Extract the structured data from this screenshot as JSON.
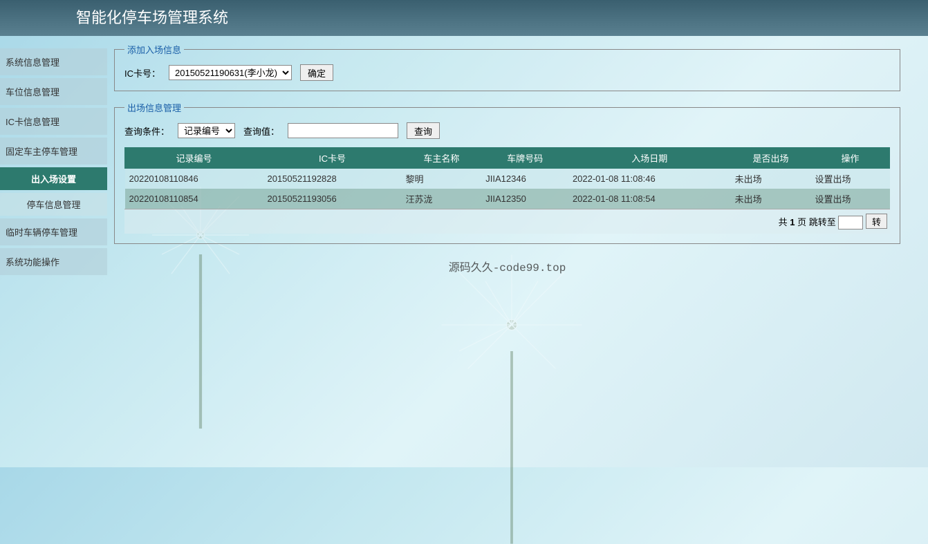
{
  "header": {
    "title": "智能化停车场管理系统"
  },
  "sidebar": {
    "items": [
      {
        "label": "系统信息管理",
        "type": "item"
      },
      {
        "label": "车位信息管理",
        "type": "item"
      },
      {
        "label": "IC卡信息管理",
        "type": "item"
      },
      {
        "label": "固定车主停车管理",
        "type": "parent"
      },
      {
        "label": "出入场设置",
        "type": "active"
      },
      {
        "label": "停车信息管理",
        "type": "sub"
      },
      {
        "label": "临时车辆停车管理",
        "type": "item"
      },
      {
        "label": "系统功能操作",
        "type": "item"
      }
    ]
  },
  "add_entry": {
    "legend": "添加入场信息",
    "ic_label": "IC卡号：",
    "ic_selected": "20150521190631(李小龙)",
    "confirm_label": "确定"
  },
  "exit_manage": {
    "legend": "出场信息管理",
    "query_cond_label": "查询条件：",
    "query_cond_selected": "记录编号",
    "query_val_label": "查询值：",
    "query_val_value": "",
    "query_button": "查询",
    "columns": [
      "记录编号",
      "IC卡号",
      "车主名称",
      "车牌号码",
      "入场日期",
      "是否出场",
      "操作"
    ],
    "rows": [
      {
        "record_no": "20220108110846",
        "ic": "20150521192828",
        "owner": "黎明",
        "plate": "JIIA12346",
        "entry_date": "2022-01-08 11:08:46",
        "exited": "未出场",
        "action": "设置出场"
      },
      {
        "record_no": "20220108110854",
        "ic": "20150521193056",
        "owner": "汪苏泷",
        "plate": "JIIA12350",
        "entry_date": "2022-01-08 11:08:54",
        "exited": "未出场",
        "action": "设置出场"
      }
    ],
    "pagination": {
      "total_prefix": "共 ",
      "total_pages": "1",
      "total_suffix": " 页 跳转至 ",
      "jump_value": "",
      "go_label": "转"
    }
  },
  "watermark": "源码久久-code99.top"
}
